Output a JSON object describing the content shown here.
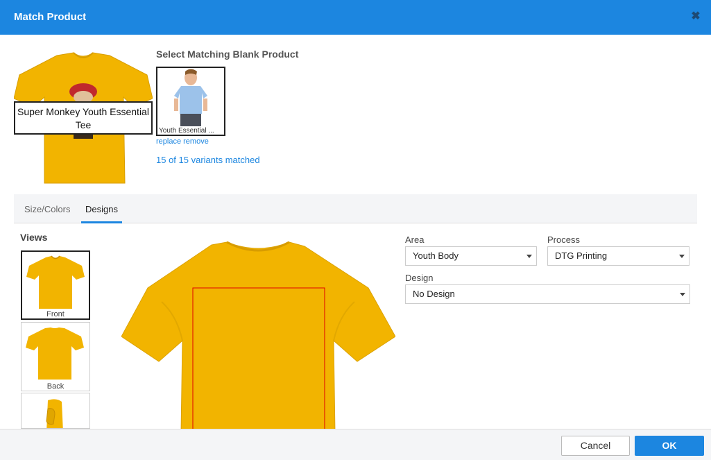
{
  "dialog": {
    "title": "Match Product",
    "close_icon": "close-icon"
  },
  "product": {
    "name": "Super Monkey Youth Essential Tee",
    "shirt_color": "#f2b400"
  },
  "blank": {
    "section_title": "Select Matching Blank Product",
    "label": "Youth Essential ...",
    "replace_link": "replace",
    "remove_link": "remove",
    "variants_status": "15 of 15 variants matched"
  },
  "tabs": [
    {
      "label": "Size/Colors",
      "active": false
    },
    {
      "label": "Designs",
      "active": true
    }
  ],
  "views": {
    "title": "Views",
    "items": [
      {
        "label": "Front",
        "active": true
      },
      {
        "label": "Back",
        "active": false
      },
      {
        "label": "",
        "active": false
      }
    ]
  },
  "form": {
    "area": {
      "label": "Area",
      "value": "Youth Body"
    },
    "process": {
      "label": "Process",
      "value": "DTG Printing"
    },
    "design": {
      "label": "Design",
      "value": "No Design"
    }
  },
  "footer": {
    "cancel_label": "Cancel",
    "ok_label": "OK"
  },
  "colors": {
    "accent": "#1c86e0",
    "print_area_outline": "#e00000"
  }
}
